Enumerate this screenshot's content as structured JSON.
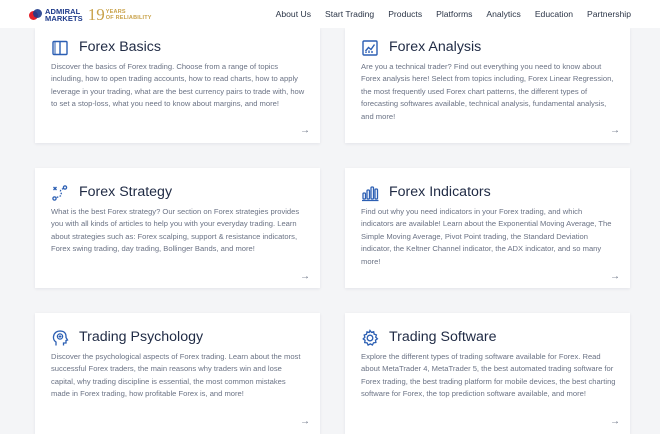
{
  "brand": {
    "logo_line1": "ADMIRAL",
    "logo_line2": "MARKETS",
    "years_number": "19",
    "years_line1": "YEARS",
    "years_line2": "OF RELIABILITY"
  },
  "colors": {
    "accent_blue": "#1e3a8a",
    "icon_blue": "#2c5fb3",
    "logo_red": "#e4202a",
    "gold": "#c9a24a"
  },
  "nav": {
    "items": [
      {
        "label": "About Us"
      },
      {
        "label": "Start Trading"
      },
      {
        "label": "Products"
      },
      {
        "label": "Platforms"
      },
      {
        "label": "Analytics"
      },
      {
        "label": "Education"
      },
      {
        "label": "Partnership"
      }
    ]
  },
  "cards": [
    {
      "icon": "book-icon",
      "title": "Forex Basics",
      "description": "Discover the basics of Forex trading. Choose from a range of topics including, how to open trading accounts, how to read charts, how to apply leverage in your trading, what are the best currency pairs to trade with, how to set a stop-loss, what you need to know about margins, and more!",
      "arrow": "→"
    },
    {
      "icon": "chart-analysis-icon",
      "title": "Forex Analysis",
      "description": "Are you a technical trader? Find out everything you need to know about Forex analysis here! Select from topics including, Forex Linear Regression, the most frequently used Forex chart patterns, the different types of forecasting softwares available, technical analysis, fundamental analysis, and more!",
      "arrow": "→"
    },
    {
      "icon": "strategy-icon",
      "title": "Forex Strategy",
      "description": "What is the best Forex strategy? Our section on Forex strategies provides you with all kinds of articles to help you with your everyday trading. Learn about strategies such as: Forex scalping, support & resistance indicators, Forex swing trading, day trading, Bollinger Bands, and more!",
      "arrow": "→"
    },
    {
      "icon": "indicators-icon",
      "title": "Forex Indicators",
      "description": "Find out why you need indicators in your Forex trading, and which indicators are available! Learn about the Exponential Moving Average, The Simple Moving Average, Pivot Point trading, the Standard Deviation indicator, the Keltner Channel indicator, the ADX indicator, and so many more!",
      "arrow": "→"
    },
    {
      "icon": "brain-head-icon",
      "title": "Trading Psychology",
      "description": "Discover the psychological aspects of Forex trading. Learn about the most successful Forex traders, the main reasons why traders win and lose capital, why trading discipline is essential, the most common mistakes made in Forex trading, how profitable Forex is, and more!",
      "arrow": "→"
    },
    {
      "icon": "gear-icon",
      "title": "Trading Software",
      "description": "Explore the different types of trading software available for Forex. Read about MetaTrader 4, MetaTrader 5, the best automated trading software for Forex trading, the best trading platform for mobile devices, the best charting software for Forex, the top prediction software available, and more!",
      "arrow": "→"
    }
  ]
}
